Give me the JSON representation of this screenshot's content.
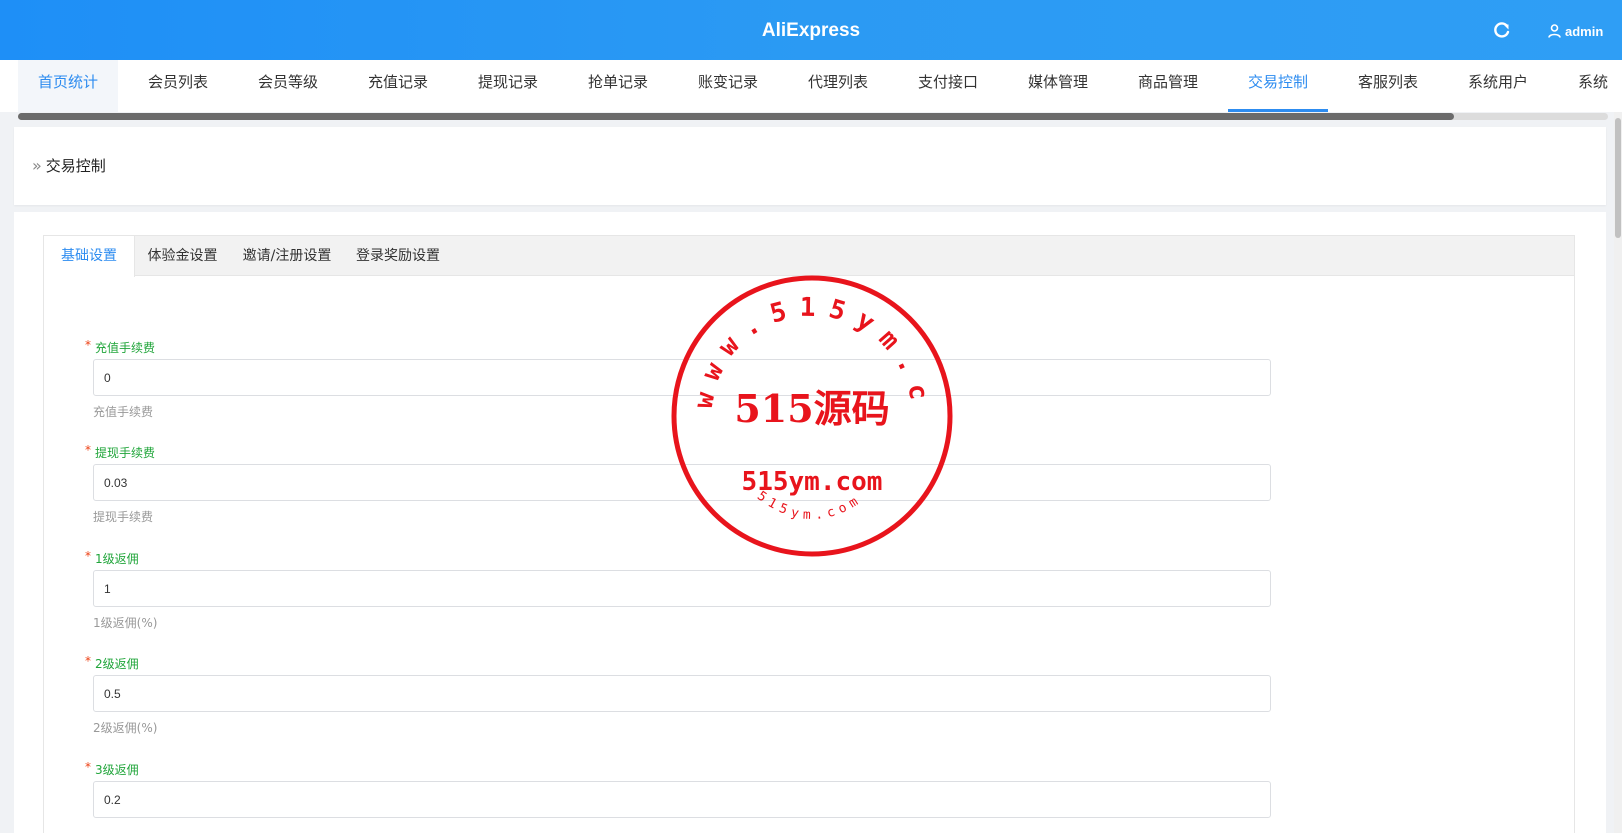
{
  "header": {
    "title": "AliExpress",
    "user_label": "admin",
    "refresh_icon": "refresh-icon",
    "user_icon": "user-icon",
    "background": "#2b9af3"
  },
  "nav": {
    "items": [
      {
        "label": "首页统计"
      },
      {
        "label": "会员列表"
      },
      {
        "label": "会员等级"
      },
      {
        "label": "充值记录"
      },
      {
        "label": "提现记录"
      },
      {
        "label": "抢单记录"
      },
      {
        "label": "账变记录"
      },
      {
        "label": "代理列表"
      },
      {
        "label": "支付接口"
      },
      {
        "label": "媒体管理"
      },
      {
        "label": "商品管理"
      },
      {
        "label": "交易控制"
      },
      {
        "label": "客服列表"
      },
      {
        "label": "系统用户"
      },
      {
        "label": "系统"
      }
    ],
    "active": "交易控制",
    "accent_color": "#2d8cf0"
  },
  "breadcrumb": {
    "separator": "»",
    "current": "交易控制"
  },
  "tabs": [
    {
      "label": "基础设置"
    },
    {
      "label": "体验金设置"
    },
    {
      "label": "邀请/注册设置"
    },
    {
      "label": "登录奖励设置"
    }
  ],
  "active_tab": "基础设置",
  "form": {
    "fields": [
      {
        "required": "*",
        "label": "充值手续费",
        "value": "0",
        "help": "充值手续费"
      },
      {
        "required": "*",
        "label": "提现手续费",
        "value": "0.03",
        "help": "提现手续费"
      },
      {
        "required": "*",
        "label": "1级返佣",
        "value": "1",
        "help": "1级返佣(%)"
      },
      {
        "required": "*",
        "label": "2级返佣",
        "value": "0.5",
        "help": "2级返佣(%)"
      },
      {
        "required": "*",
        "label": "3级返佣",
        "value": "0.2",
        "help": ""
      }
    ],
    "label_color": "#20a53a",
    "required_color": "#ed4014"
  },
  "watermark": {
    "ring_text": "www.515ym.com",
    "main_text": "515源码",
    "sub_text": "515ym.com",
    "bottom_text": "515ym.com",
    "color": "#e8141c"
  }
}
